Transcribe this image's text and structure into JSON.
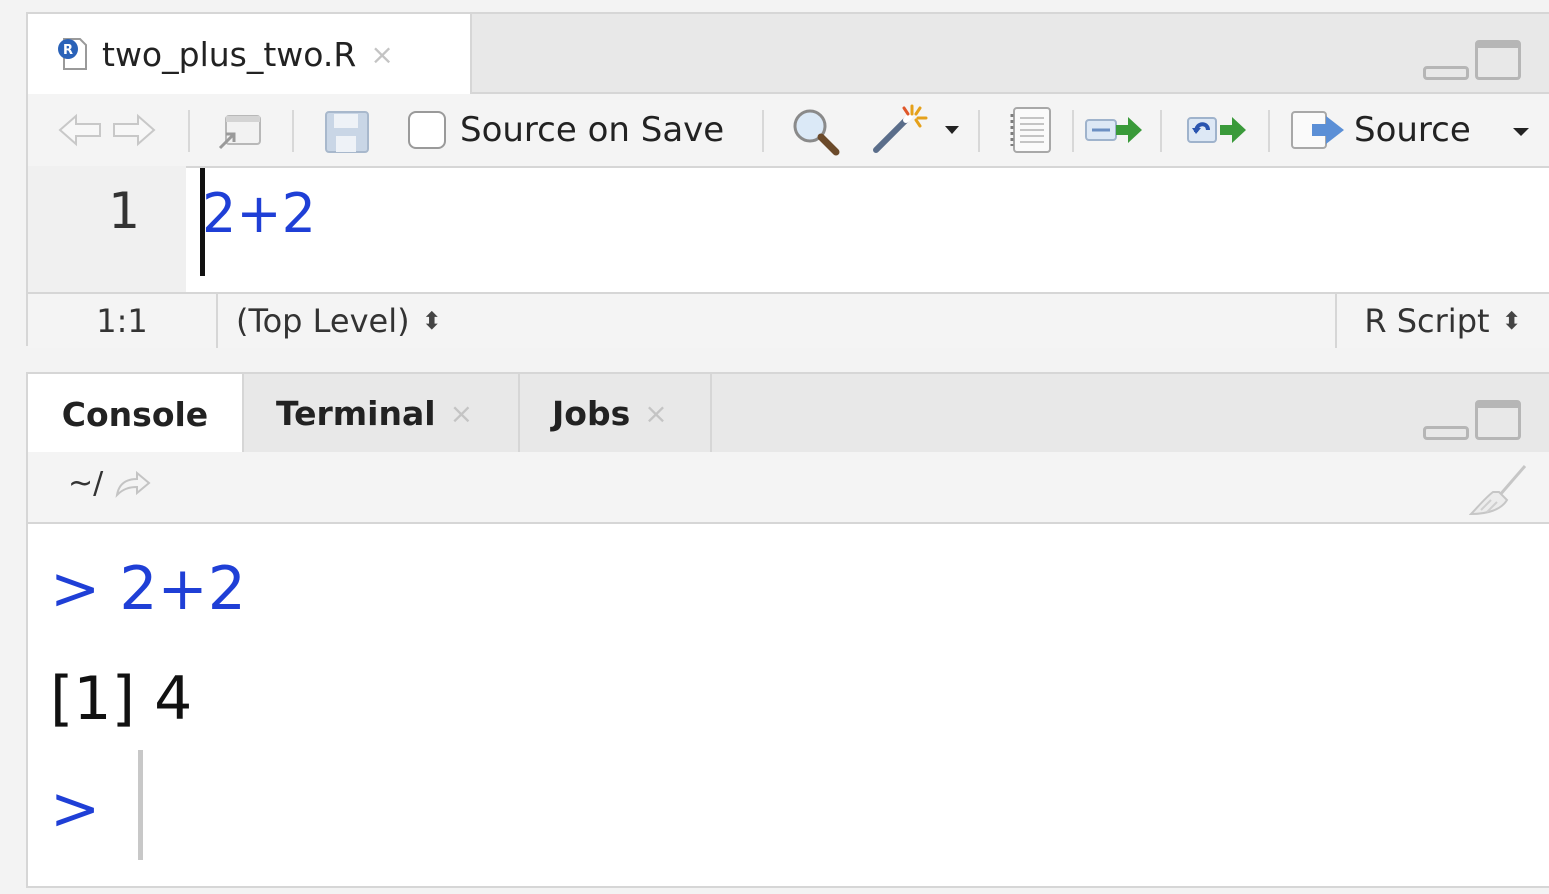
{
  "editor": {
    "tab": {
      "filename": "two_plus_two.R",
      "close": "×"
    },
    "toolbar": {
      "source_on_save_label": "Source on Save",
      "source_on_save_checked": false,
      "source_label": "Source"
    },
    "code": {
      "line_number": "1",
      "line_text": "2+2"
    },
    "status": {
      "position": "1:1",
      "scope": "(Top Level)",
      "file_type": "R Script",
      "updown": "⬍"
    }
  },
  "console": {
    "tabs": [
      {
        "label": "Console"
      },
      {
        "label": "Terminal",
        "close": "×"
      },
      {
        "label": "Jobs",
        "close": "×"
      }
    ],
    "path": "~/",
    "lines": {
      "input": "> 2+2",
      "output": "[1] 4",
      "prompt": ">"
    }
  },
  "colors": {
    "code_blue": "#1f3fd6",
    "panel_border": "#d6d6d6"
  }
}
